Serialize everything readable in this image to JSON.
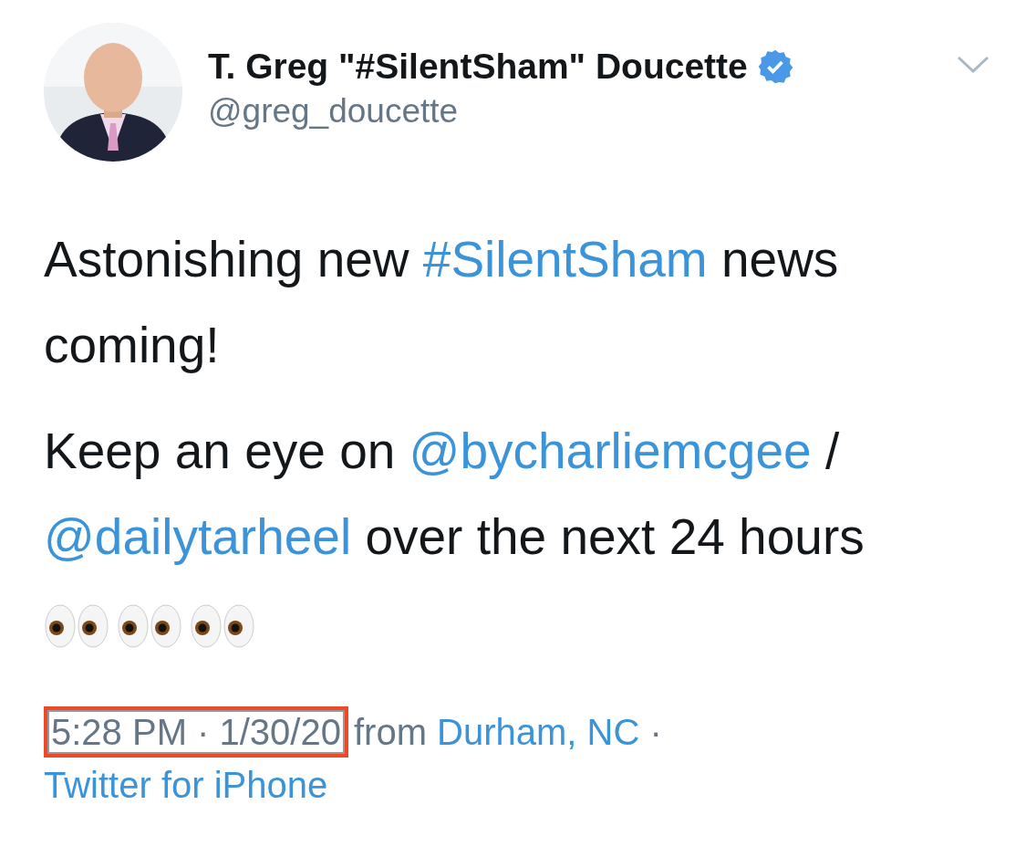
{
  "author": {
    "name": "T. Greg \"#SilentSham\" Doucette",
    "verified": true,
    "handle": "@greg_doucette"
  },
  "paragraphs": [
    [
      {
        "kind": "text",
        "text": "Astonishing new "
      },
      {
        "kind": "link",
        "text": "#SilentSham"
      },
      {
        "kind": "text",
        "text": " news coming!"
      }
    ],
    [
      {
        "kind": "text",
        "text": "Keep an eye on "
      },
      {
        "kind": "link",
        "text": "@bycharliemcgee"
      },
      {
        "kind": "text",
        "text": " / "
      },
      {
        "kind": "link",
        "text": "@dailytarheel"
      },
      {
        "kind": "text",
        "text": " over the next 24 hours"
      }
    ]
  ],
  "emojis": [
    {
      "kind": "eyes"
    },
    {
      "kind": "eyes"
    },
    {
      "kind": "eyes"
    }
  ],
  "meta": [
    {
      "kind": "time",
      "text": "5:28 PM · 1/30/20",
      "highlighted": true
    },
    {
      "kind": "text",
      "text": "from "
    },
    {
      "kind": "link",
      "text": "Durham, NC"
    },
    {
      "kind": "text",
      "text": " · "
    },
    {
      "kind": "link",
      "text": "Twitter for iPhone"
    }
  ]
}
